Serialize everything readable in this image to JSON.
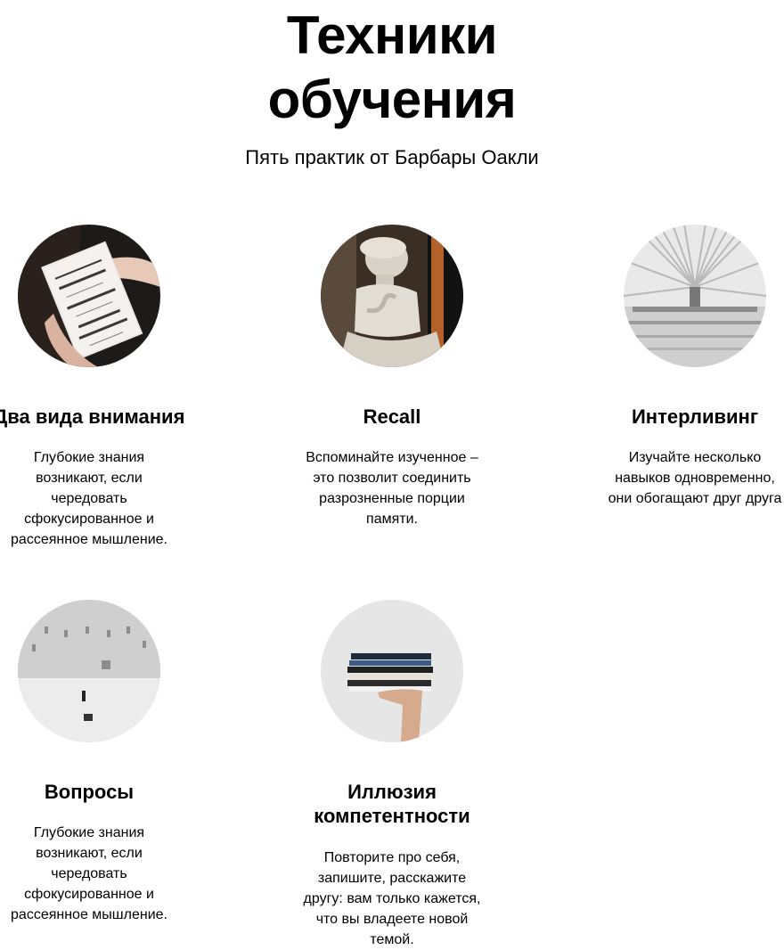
{
  "header": {
    "title": "Техники\nобучения",
    "subtitle": "Пять практик от Барбары Оакли"
  },
  "cards": [
    {
      "image": "book-in-hands-image",
      "title": "Два вида внимания",
      "text": "Глубокие знания\nвозникают, если\nчередовать\nсфокусированное и\nрассеянное мышление."
    },
    {
      "image": "marble-statue-image",
      "title": "Recall",
      "text": "Вспоминайте изученное –\nэто позволит соединить\nразрозненные порции\nпамяти."
    },
    {
      "image": "architecture-hall-image",
      "title": "Интерливинг",
      "text": "Изучайте несколько\nнавыков одновременно,\nони обогащают друг друга"
    },
    {
      "image": "white-room-image",
      "title": "Вопросы",
      "text": "Глубокие знания\nвозникают, если\nчередовать\nсфокусированное и\nрассеянное мышление."
    },
    {
      "image": "book-stack-hand-image",
      "title": "Иллюзия\nкомпетентности",
      "text": "Повторите про себя,\nзапишите, расскажите\nдругу: вам только кажется,\nчто вы владеете новой\nтемой."
    }
  ]
}
